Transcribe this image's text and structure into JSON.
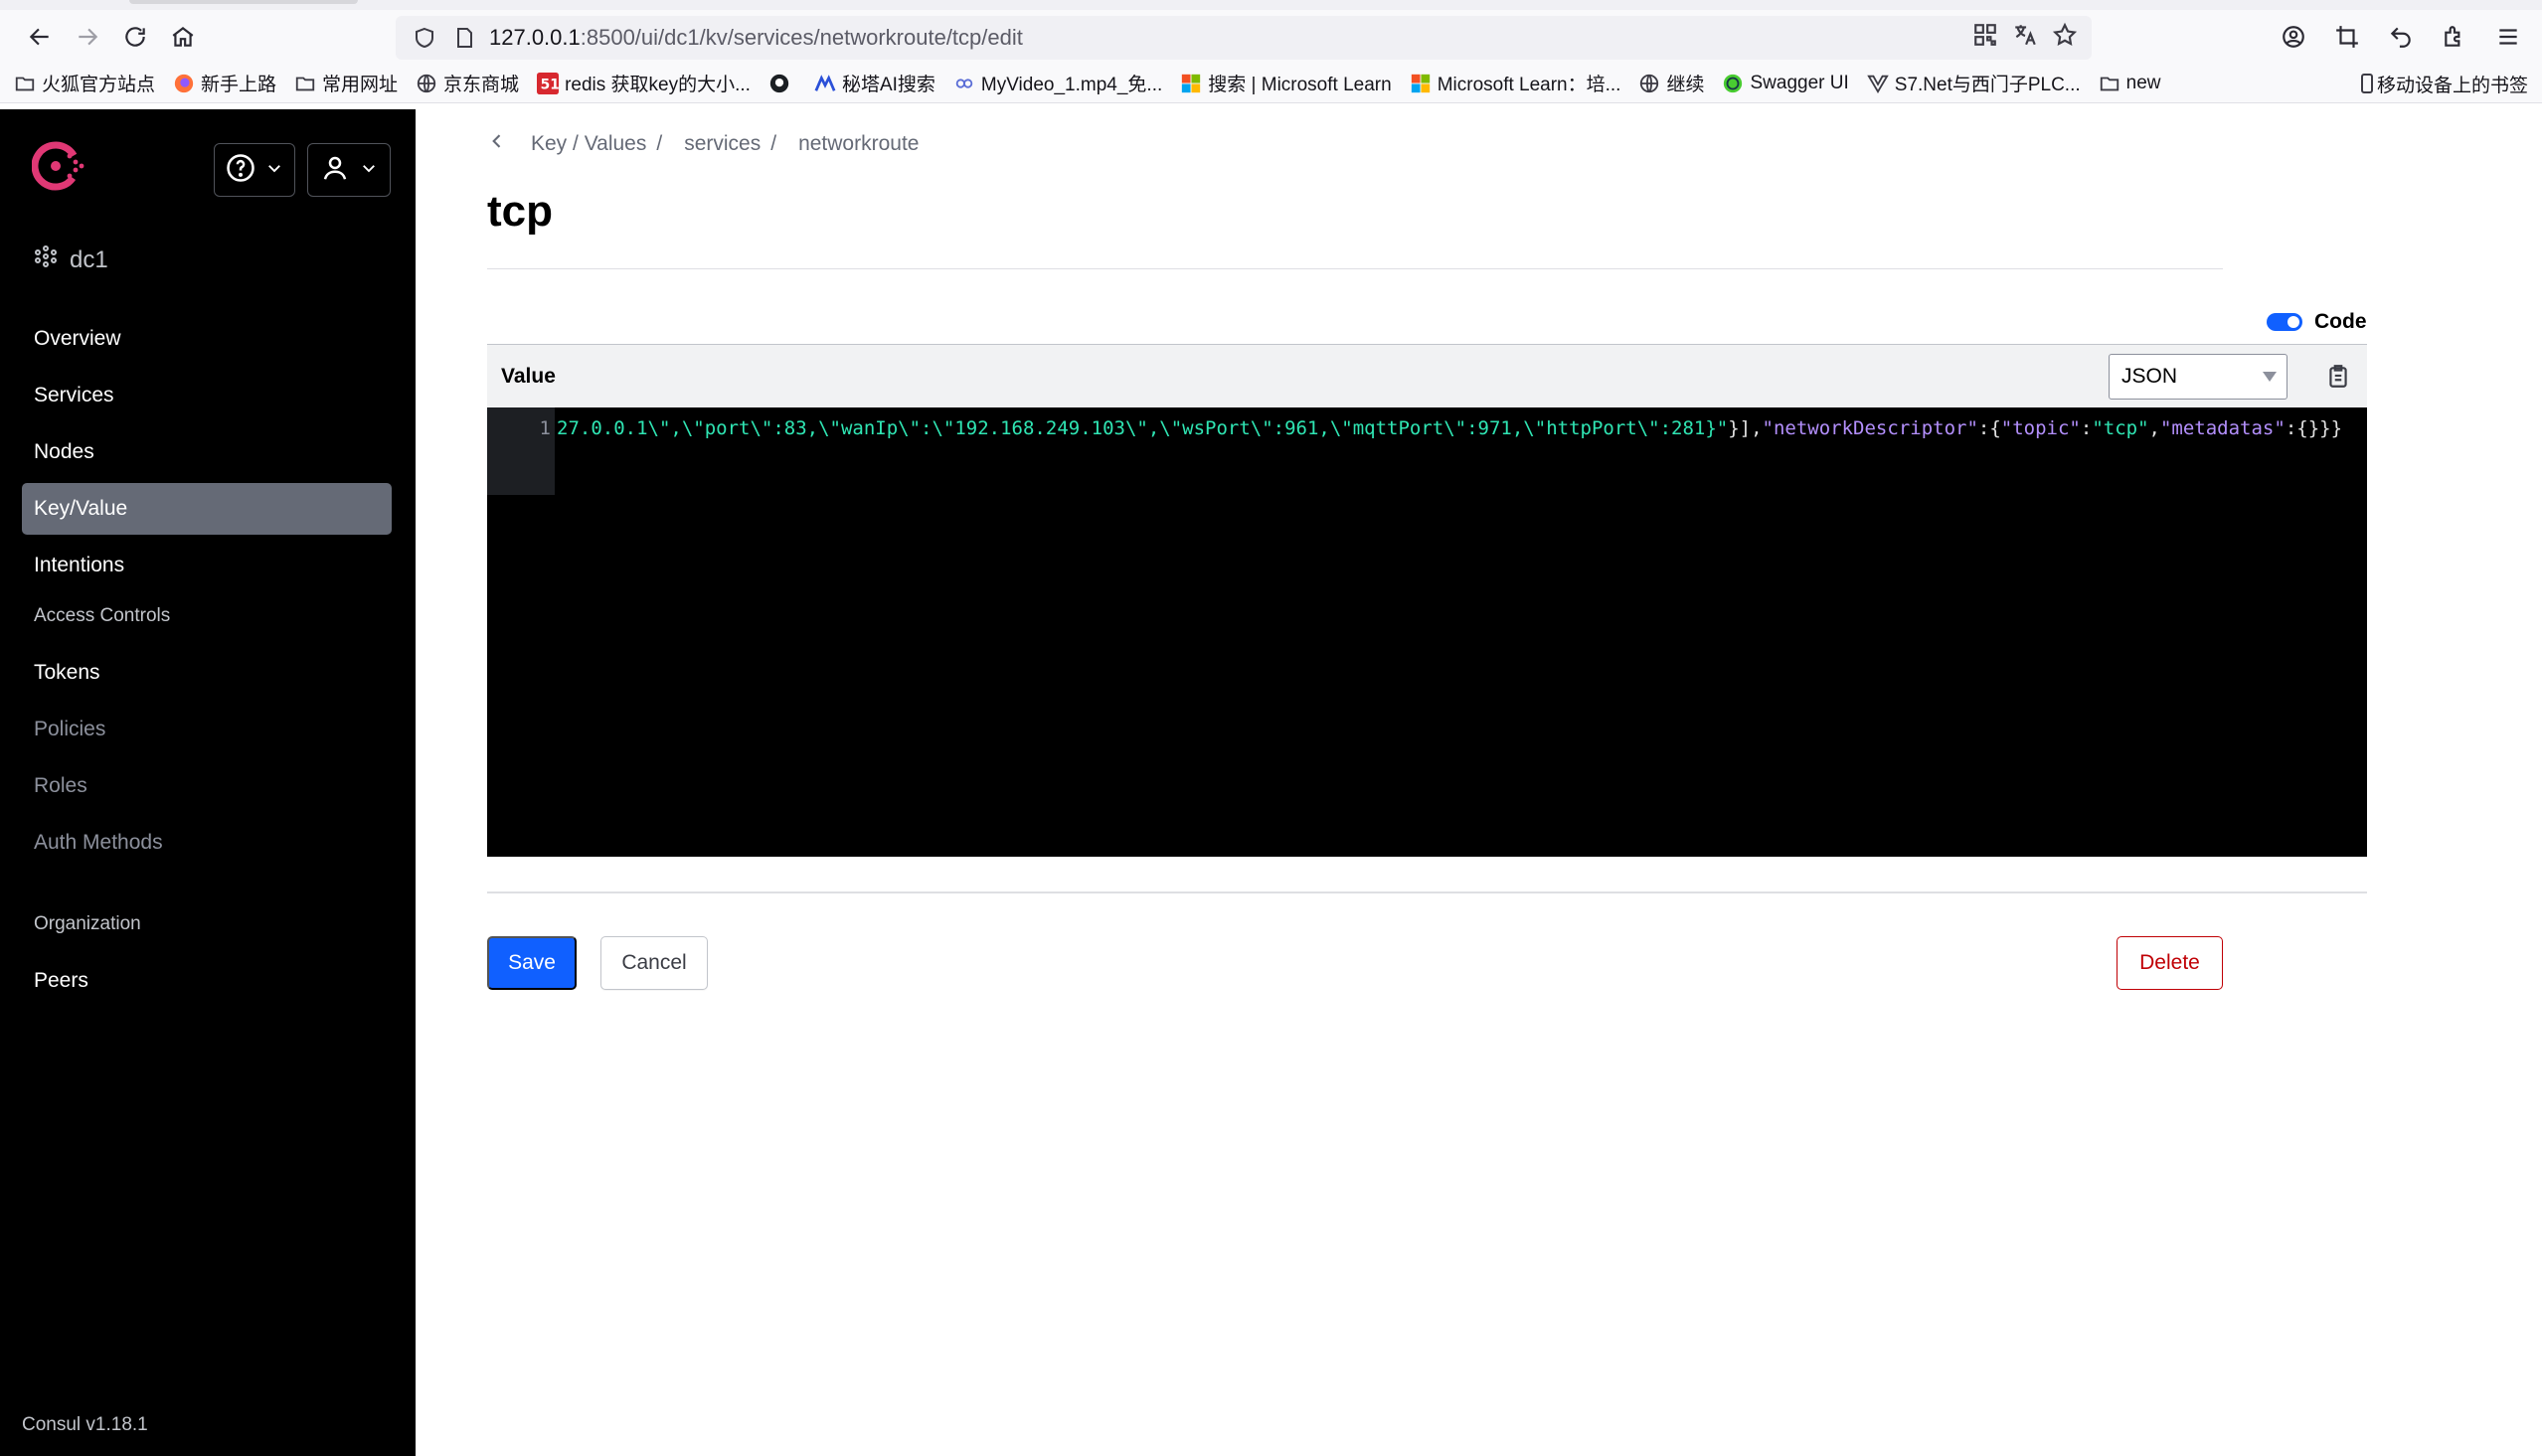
{
  "browser": {
    "url_host": "127.0.0.1",
    "url_path": ":8500/ui/dc1/kv/services/networkroute/tcp/edit",
    "bookmarks": [
      {
        "label": "火狐官方站点",
        "icon": "folder-icon"
      },
      {
        "label": "新手上路",
        "icon": "firefox-icon"
      },
      {
        "label": "常用网址",
        "icon": "folder-icon"
      },
      {
        "label": "京东商城",
        "icon": "globe-icon"
      },
      {
        "label": "redis 获取key的大小...",
        "icon": "cnblogs-icon"
      },
      {
        "label": "",
        "icon": "github-icon"
      },
      {
        "label": "秘塔AI搜索",
        "icon": "metaso-icon"
      },
      {
        "label": "MyVideo_1.mp4_免...",
        "icon": "video-icon"
      },
      {
        "label": "搜索 | Microsoft Learn",
        "icon": "microsoft-icon"
      },
      {
        "label": "Microsoft Learn：培...",
        "icon": "microsoft-icon"
      },
      {
        "label": "继续",
        "icon": "globe-icon"
      },
      {
        "label": "Swagger UI",
        "icon": "swagger-icon"
      },
      {
        "label": "S7.Net与西门子PLC...",
        "icon": "vue-icon"
      },
      {
        "label": "new",
        "icon": "folder-icon"
      }
    ],
    "mobile_bookmarks": "移动设备上的书签"
  },
  "sidebar": {
    "datacenter": "dc1",
    "nav": [
      {
        "label": "Overview",
        "active": false,
        "muted": false
      },
      {
        "label": "Services",
        "active": false,
        "muted": false
      },
      {
        "label": "Nodes",
        "active": false,
        "muted": false
      },
      {
        "label": "Key/Value",
        "active": true,
        "muted": false
      },
      {
        "label": "Intentions",
        "active": false,
        "muted": false
      }
    ],
    "access_heading": "Access Controls",
    "access_nav": [
      {
        "label": "Tokens",
        "muted": false
      },
      {
        "label": "Policies",
        "muted": true
      },
      {
        "label": "Roles",
        "muted": true
      },
      {
        "label": "Auth Methods",
        "muted": true
      }
    ],
    "org_heading": "Organization",
    "org_nav": [
      {
        "label": "Peers",
        "muted": false
      }
    ],
    "version": "Consul v1.18.1"
  },
  "main": {
    "breadcrumb": [
      "Key / Values",
      "services",
      "networkroute"
    ],
    "title": "tcp",
    "code_toggle_label": "Code",
    "code_toggle_on": true,
    "value_label": "Value",
    "mode_selected": "JSON",
    "line_number": "1",
    "code_tokens": [
      {
        "t": "27.0.0.1\\\",\\\"port\\\":83,\\\"wanIp\\\":\\\"192.168.249.103\\\",\\\"wsPort\\\":961,\\\"mqttPort\\\":971,\\\"httpPort\\\":281}\"",
        "c": "str"
      },
      {
        "t": "}],",
        "c": "punc"
      },
      {
        "t": "\"networkDescriptor\"",
        "c": "key"
      },
      {
        "t": ":{",
        "c": "punc"
      },
      {
        "t": "\"topic\"",
        "c": "key"
      },
      {
        "t": ":",
        "c": "punc"
      },
      {
        "t": "\"tcp\"",
        "c": "str"
      },
      {
        "t": ",",
        "c": "punc"
      },
      {
        "t": "\"metadatas\"",
        "c": "key"
      },
      {
        "t": ":{}}}",
        "c": "punc"
      }
    ],
    "buttons": {
      "save": "Save",
      "cancel": "Cancel",
      "delete": "Delete"
    }
  },
  "colors": {
    "primary": "#1060ff",
    "danger": "#c00005",
    "sidebar_bg": "#000000",
    "active_nav": "#656a76",
    "code_string": "#2fe5b3",
    "code_key": "#b38ffc"
  }
}
